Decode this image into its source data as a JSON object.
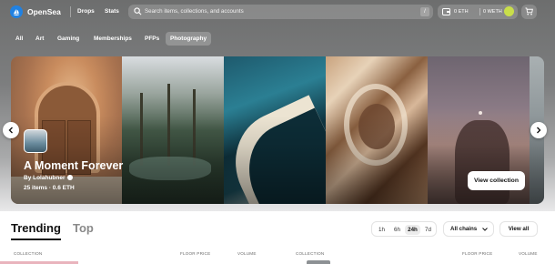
{
  "header": {
    "brand": "OpenSea",
    "nav": [
      "Drops",
      "Stats"
    ],
    "search_placeholder": "Search items, collections, and accounts",
    "search_shortcut": "/",
    "wallet_eth": "0 ETH",
    "wallet_weth": "0 WETH"
  },
  "categories": [
    {
      "label": "All",
      "active": false
    },
    {
      "label": "Art",
      "active": false
    },
    {
      "label": "Gaming",
      "active": false
    },
    {
      "label": "Memberships",
      "active": false
    },
    {
      "label": "PFPs",
      "active": false
    },
    {
      "label": "Photography",
      "active": true
    }
  ],
  "featured": {
    "title": "A Moment Forever",
    "creator": "By Lolahubner",
    "stats": "25 items · 0.6 ETH",
    "cta": "View collection"
  },
  "rankings": {
    "tabs": [
      "Trending",
      "Top"
    ],
    "active_tab": "Trending",
    "ranges": [
      "1h",
      "6h",
      "24h",
      "7d"
    ],
    "active_range": "24h",
    "chain_filter": "All chains",
    "view_all": "View all",
    "columns_left": [
      "COLLECTION",
      "FLOOR PRICE",
      "VOLUME"
    ],
    "columns_right": [
      "COLLECTION",
      "FLOOR PRICE",
      "VOLUME"
    ]
  },
  "colors": {
    "brand": "#2081e2",
    "avatar": "#c9de4a"
  }
}
